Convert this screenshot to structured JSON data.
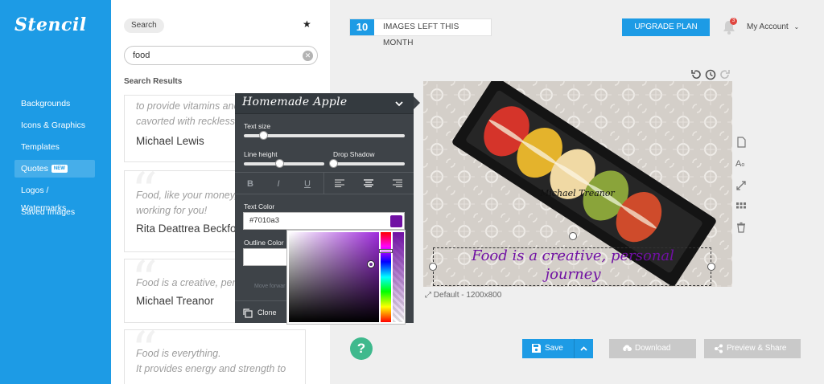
{
  "app": {
    "logo": "Stencil",
    "brand_color": "#1d9be5"
  },
  "sidebar": {
    "items": [
      {
        "label": "Backgrounds"
      },
      {
        "label": "Icons & Graphics"
      },
      {
        "label": "Templates"
      },
      {
        "label": "Quotes",
        "badge": "NEW",
        "active": true
      },
      {
        "label": "Logos / Watermarks"
      },
      {
        "label": "Saved Images"
      }
    ]
  },
  "search": {
    "tag": "Search",
    "query": "food",
    "results_title": "Search Results",
    "results": [
      {
        "text": "to provide vitamins and\ncavorted with reckless",
        "author": "Michael Lewis"
      },
      {
        "text": "Food, like your money,\nworking for you!",
        "author": "Rita Deattrea Beckford"
      },
      {
        "text": "Food is a creative, persona",
        "author": "Michael Treanor"
      },
      {
        "text": "Food is everything.\nIt provides energy and strength to",
        "author": ""
      }
    ]
  },
  "topbar": {
    "images_left": "10",
    "images_left_label": "IMAGES LEFT THIS MONTH",
    "upgrade_label": "UPGRADE PLAN",
    "notifications_count": "3",
    "account_label": "My Account"
  },
  "editor": {
    "font_name": "Homemade Apple",
    "text_size_label": "Text size",
    "text_size_value": 0.12,
    "line_height_label": "Line height",
    "line_height_value": 0.44,
    "drop_shadow_label": "Drop Shadow",
    "drop_shadow_value": 0.0,
    "format_buttons": [
      "B",
      "I",
      "U"
    ],
    "align_buttons": [
      "left-align-icon",
      "center-align-icon",
      "right-align-icon"
    ],
    "text_color_label": "Text Color",
    "text_color_value": "#7010a3",
    "outline_color_label": "Outline Color",
    "move_text": "Move forwar",
    "clone_label": "Clone"
  },
  "canvas": {
    "caption": "Default - 1200x800",
    "quote_text": "Food is a creative, personal journey",
    "author_text": "Michael Treanor",
    "quote_color": "#7010a3"
  },
  "actions": {
    "help": "?",
    "save": "Save",
    "download": "Download",
    "preview_share": "Preview & Share"
  }
}
